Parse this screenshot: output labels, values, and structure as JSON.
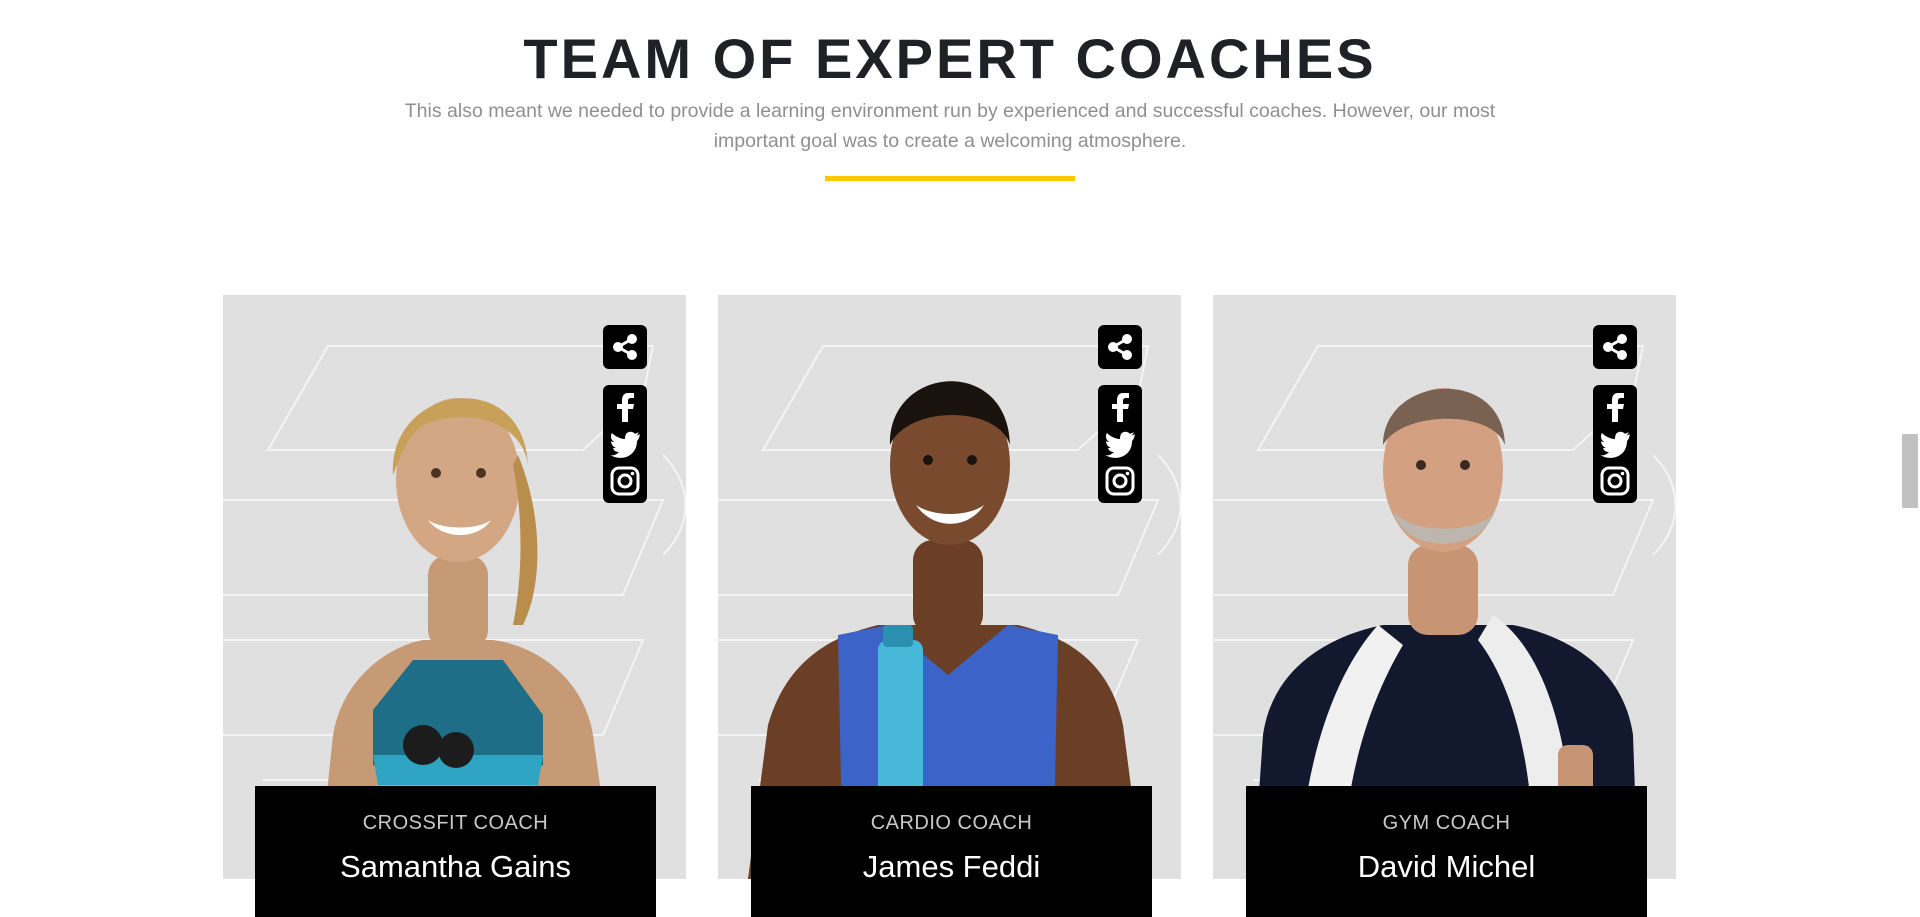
{
  "header": {
    "title": "TEAM OF EXPERT COACHES",
    "subtitle_line1": "This also meant we needed to provide a learning environment run by experienced and successful coaches. However, our most",
    "subtitle_line2": "important goal was to create a welcoming atmosphere."
  },
  "colors": {
    "accent": "#ffc700",
    "card_bg": "#e0e0e0",
    "plate_bg": "#000000"
  },
  "coaches": [
    {
      "role": "CROSSFIT COACH",
      "name": "Samantha Gains",
      "photo": "female-athlete-photo",
      "socials": [
        "facebook-icon",
        "twitter-icon",
        "instagram-icon"
      ]
    },
    {
      "role": "CARDIO COACH",
      "name": "James Feddi",
      "photo": "male-athlete-photo",
      "socials": [
        "facebook-icon",
        "twitter-icon",
        "instagram-icon"
      ]
    },
    {
      "role": "GYM COACH",
      "name": "David Michel",
      "photo": "senior-athlete-photo",
      "socials": [
        "facebook-icon",
        "twitter-icon",
        "instagram-icon"
      ]
    }
  ]
}
